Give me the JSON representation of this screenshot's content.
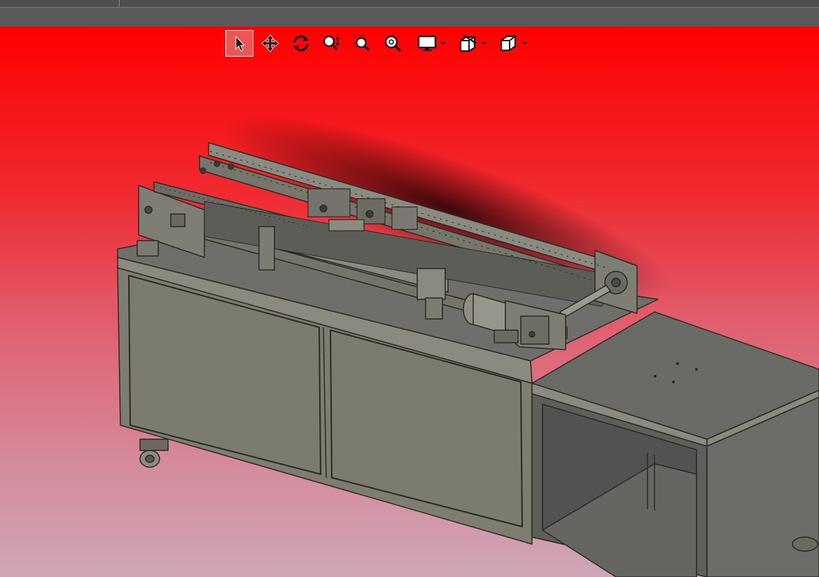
{
  "app": {
    "tabs": []
  },
  "toolbar": {
    "tools": [
      {
        "name": "select-tool",
        "icon": "arrow-cursor-icon",
        "active": true
      },
      {
        "name": "pan-tool",
        "icon": "move-arrows-icon",
        "active": false
      },
      {
        "name": "rotate-tool",
        "icon": "rotate-icon",
        "active": false
      },
      {
        "name": "zoom-tool",
        "icon": "zoom-in-out-icon",
        "active": false
      },
      {
        "name": "zoom-window-tool",
        "icon": "zoom-window-icon",
        "active": false
      },
      {
        "name": "zoom-fit-tool",
        "icon": "zoom-fit-icon",
        "active": false
      }
    ],
    "dropdowns": [
      {
        "name": "display-mode-menu",
        "icon": "monitor-icon"
      },
      {
        "name": "section-view-menu",
        "icon": "section-cube-icon"
      },
      {
        "name": "standard-views-menu",
        "icon": "view-cube-icon"
      }
    ]
  },
  "viewport": {
    "background_top": "#ff0000",
    "background_bottom": "#cfa6b6",
    "model_color": "#7d7d72",
    "model_edge": "#2a2a25"
  }
}
